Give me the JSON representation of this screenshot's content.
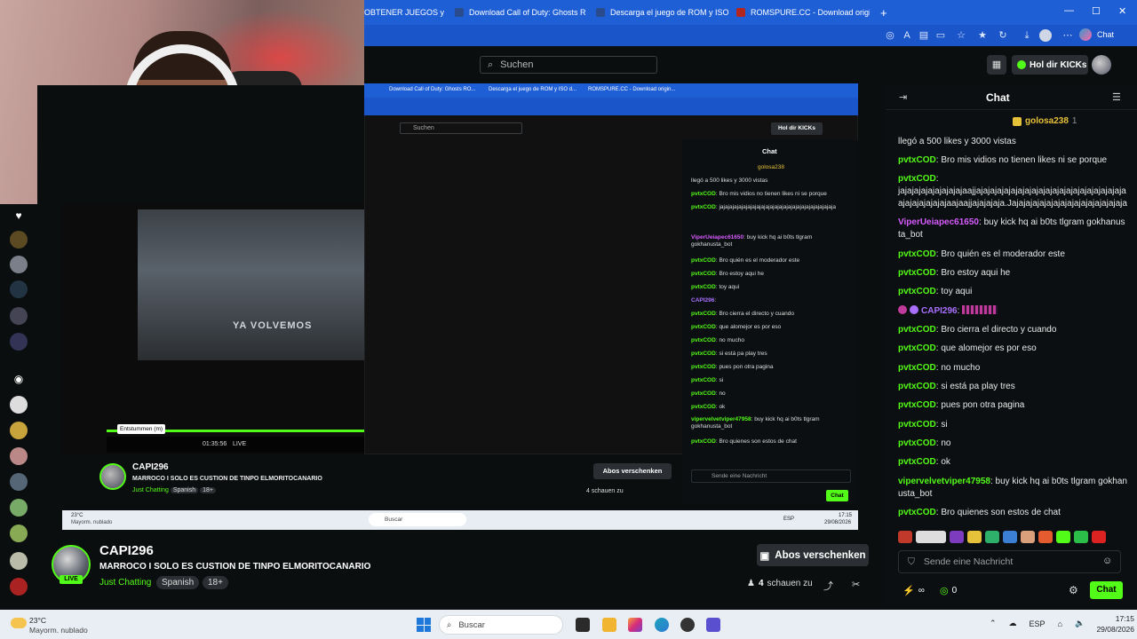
{
  "browser": {
    "tabs": [
      {
        "label": "OBTENER JUEGOS y R..."
      },
      {
        "label": "Download Call of Duty: Ghosts RO..."
      },
      {
        "label": "Descarga el juego de ROM y ISO d..."
      },
      {
        "label": "ROMSPURE.CC - Download origin..."
      }
    ],
    "new_tab": "+",
    "copilot_label": "Chat"
  },
  "site": {
    "search_placeholder": "Suchen",
    "user_button": "Hol dir KICKs"
  },
  "inner_view": {
    "tabs": [
      "Download Call of Duty: Ghosts RO...",
      "Descarga el juego de ROM y ISO d...",
      "ROMSPURE.CC - Download origin..."
    ],
    "search": "Suchen",
    "user_button": "Hol dir KICKs",
    "chat_title": "Chat",
    "pinned": "golosa238",
    "video_overlay_text": "YA VOLVEMOS",
    "tooltip": "Entstummen (m)",
    "time": "01:35:56",
    "live": "LIVE",
    "channel": "CAPI296",
    "title": "MARROCO I SOLO ES CUSTION DE TINPO ELMORITOCANARIO",
    "category": "Just Chatting",
    "lang": "Spanish",
    "age": "18+",
    "follow": "Abos verschenken",
    "viewers": "4 schauen zu",
    "chat_input": "Sende eine Nachricht",
    "chat_send": "Chat",
    "chat_lines": [
      {
        "text": "llegó a 500 likes y 3000 vistas"
      },
      {
        "user": "pvtxCOD",
        "text": "Bro mis vidios no tienen likes ni se porque"
      },
      {
        "user": "pvtxCOD",
        "text": "jajajajajajajajajajajajajajajajajajajajajajajajajaja"
      },
      {
        "user": "ViperUeiapec61650",
        "text": "buy kick hq ai b0ts tlgram gokhanusta_bot"
      },
      {
        "user": "pvtxCOD",
        "text": "Bro quién es el moderador este"
      },
      {
        "user": "pvtxCOD",
        "text": "Bro estoy aqui he"
      },
      {
        "user": "pvtxCOD",
        "text": "toy aqui"
      },
      {
        "user": "CAPI296",
        "text": ""
      },
      {
        "user": "pvtxCOD",
        "text": "Bro cierra el directo y cuando"
      },
      {
        "user": "pvtxCOD",
        "text": "que alomejor es por eso"
      },
      {
        "user": "pvtxCOD",
        "text": "no mucho"
      },
      {
        "user": "pvtxCOD",
        "text": "si está pa play tres"
      },
      {
        "user": "pvtxCOD",
        "text": "pues pon otra pagina"
      },
      {
        "user": "pvtxCOD",
        "text": "si"
      },
      {
        "user": "pvtxCOD",
        "text": "no"
      },
      {
        "user": "pvtxCOD",
        "text": "ok"
      },
      {
        "user": "vipervelvetviper47958",
        "text": "buy kick hq ai b0ts tlgram gokhanusta_bot"
      },
      {
        "user": "pvtxCOD",
        "text": "Bro quienes son estos de chat"
      }
    ],
    "taskbar_search": "Buscar",
    "taskbar_temp": "23°C",
    "taskbar_weather": "Mayorm. nublado",
    "taskbar_lang": "ESP",
    "taskbar_time": "17:15",
    "taskbar_date": "29/08/2026"
  },
  "channel": {
    "name": "CAPI296",
    "live_badge": "LIVE",
    "title": "MARROCO I SOLO ES CUSTION DE TINPO ELMORITOCANARIO",
    "category": "Just Chatting",
    "tags": [
      "Spanish",
      "18+"
    ],
    "follow_label": "Abos verschenken",
    "viewers_count": "4",
    "viewers_label": "schauen zu"
  },
  "chat": {
    "title": "Chat",
    "pinned_user": "golosa238",
    "pinned_count": "1",
    "messages": [
      {
        "user": "",
        "text": "llegó a 500 likes y 3000 vistas",
        "color": "#53fc18"
      },
      {
        "user": "pvtxCOD",
        "text": "Bro mis vidios no tienen likes ni se porque",
        "color": "#53fc18"
      },
      {
        "user": "pvtxCOD",
        "text": "jajajajajajajajajajaajjajajajajajajajajajajajajajajajajajajajajajaajajajajajajajaajaajjajajajaja.Jajajajajajajajajajajajajajajajaja",
        "color": "#53fc18"
      },
      {
        "user": "ViperUeiapec61650",
        "text": "buy kick hq ai b0ts tlgram gokhanusta_bot",
        "color": "#d65cff"
      },
      {
        "user": "pvtxCOD",
        "text": "Bro quién es el moderador este",
        "color": "#53fc18"
      },
      {
        "user": "pvtxCOD",
        "text": "Bro estoy aqui he",
        "color": "#53fc18"
      },
      {
        "user": "pvtxCOD",
        "text": "toy aqui",
        "color": "#53fc18"
      },
      {
        "user": "CAPI296",
        "text": "",
        "color": "#a970ff"
      },
      {
        "user": "pvtxCOD",
        "text": "Bro cierra el directo y cuando",
        "color": "#53fc18"
      },
      {
        "user": "pvtxCOD",
        "text": "que alomejor es por eso",
        "color": "#53fc18"
      },
      {
        "user": "pvtxCOD",
        "text": "no mucho",
        "color": "#53fc18"
      },
      {
        "user": "pvtxCOD",
        "text": "si está pa play tres",
        "color": "#53fc18"
      },
      {
        "user": "pvtxCOD",
        "text": "pues pon otra pagina",
        "color": "#53fc18"
      },
      {
        "user": "pvtxCOD",
        "text": "si",
        "color": "#53fc18"
      },
      {
        "user": "pvtxCOD",
        "text": "no",
        "color": "#53fc18"
      },
      {
        "user": "pvtxCOD",
        "text": "ok",
        "color": "#53fc18"
      },
      {
        "user": "vipervelvetviper47958",
        "text": "buy kick hq ai b0ts tlgram gokhanusta_bot",
        "color": "#53fc18"
      },
      {
        "user": "pvtxCOD",
        "text": "Bro quienes son estos de chat",
        "color": "#53fc18"
      }
    ],
    "input_placeholder": "Sende eine Nachricht",
    "points_value": "∞",
    "coins_value": "0",
    "send_label": "Chat"
  },
  "taskbar": {
    "temperature": "23°C",
    "weather": "Mayorm. nublado",
    "search_label": "Buscar",
    "language": "ESP",
    "time": "17:15",
    "date": "29/08/2026"
  },
  "colors": {
    "kick_green": "#53fc18",
    "browser_blue": "#1f5fd6",
    "background": "#0b0e0f"
  }
}
